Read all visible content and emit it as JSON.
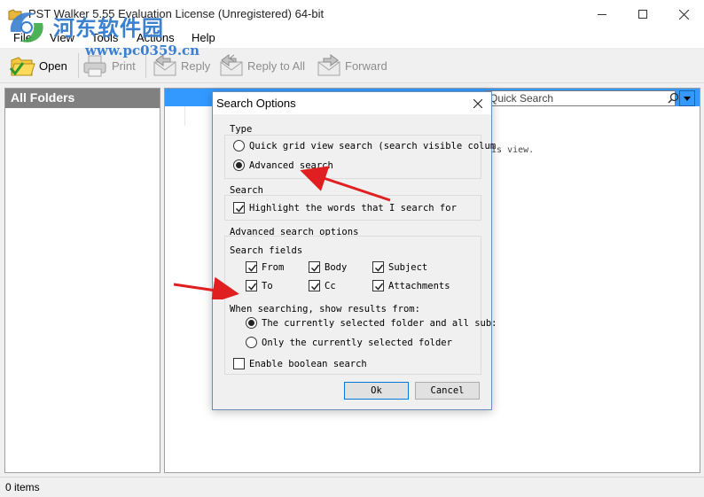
{
  "window": {
    "title": "PST Walker 5.55 Evaluation License (Unregistered) 64-bit",
    "controls": [
      "minimize-icon",
      "maximize-icon",
      "close-icon"
    ]
  },
  "watermark": {
    "chinese": "河东软件园",
    "url": "www.pc0359.cn"
  },
  "menu": {
    "items": [
      {
        "label": "File"
      },
      {
        "label": "View"
      },
      {
        "label": "Tools"
      },
      {
        "label": "Actions"
      },
      {
        "label": "Help"
      }
    ]
  },
  "toolbar": {
    "buttons": [
      {
        "label": "Open",
        "icon": "open-folder-icon",
        "enabled": true
      },
      {
        "label": "Print",
        "icon": "printer-icon",
        "enabled": false
      },
      {
        "label": "Reply",
        "icon": "reply-icon",
        "enabled": false
      },
      {
        "label": "Reply to All",
        "icon": "reply-all-icon",
        "enabled": false
      },
      {
        "label": "Forward",
        "icon": "forward-icon",
        "enabled": false
      }
    ]
  },
  "folders": {
    "header": "All Folders"
  },
  "main": {
    "quick_search_placeholder": "Quick Search",
    "empty_text_fragment": "his view."
  },
  "status": {
    "text": "0 items"
  },
  "dialog": {
    "title": "Search Options",
    "type_group": {
      "label": "Type",
      "options": [
        {
          "label": "Quick grid view search (search visible colum",
          "selected": false
        },
        {
          "label": "Advanced search",
          "selected": true
        }
      ]
    },
    "search_group": {
      "label": "Search",
      "highlight": {
        "label": "Highlight the words that I search for",
        "checked": true
      }
    },
    "advanced_group": {
      "label": "Advanced search options",
      "fields_label": "Search fields",
      "fields": [
        {
          "label": "From",
          "checked": true
        },
        {
          "label": "Body",
          "checked": true
        },
        {
          "label": "Subject",
          "checked": true
        },
        {
          "label": "To",
          "checked": true
        },
        {
          "label": "Cc",
          "checked": true
        },
        {
          "label": "Attachments",
          "checked": true
        }
      ],
      "results_label": "When searching, show results from:",
      "results_options": [
        {
          "label": "The currently selected folder and all sub:",
          "selected": true
        },
        {
          "label": "Only the currently selected folder",
          "selected": false
        }
      ],
      "boolean": {
        "label": "Enable boolean search",
        "checked": false
      }
    },
    "ok_label": "Ok",
    "cancel_label": "Cancel"
  },
  "colors": {
    "selection_blue": "#3399ff",
    "arrow_red": "#e02020",
    "watermark_blue": "#3a7fd0"
  }
}
